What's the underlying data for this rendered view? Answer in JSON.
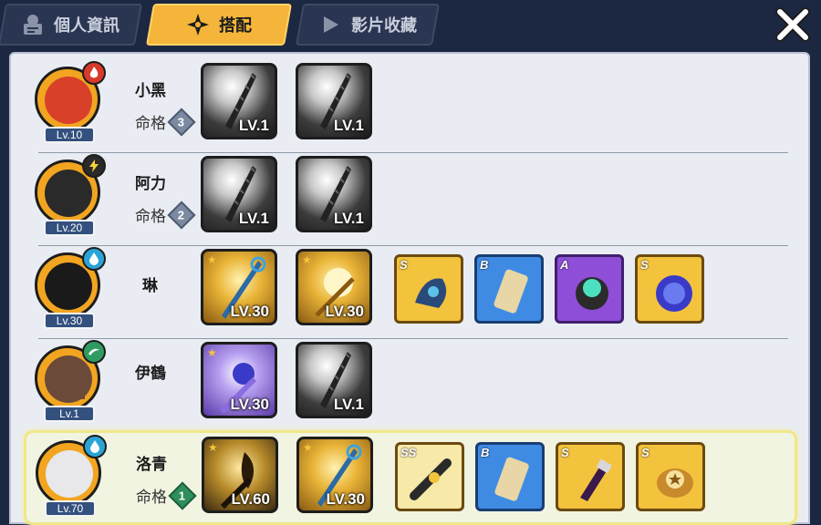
{
  "tabs": [
    {
      "label": "個人資訊",
      "icon": "profile-icon"
    },
    {
      "label": "搭配",
      "icon": "shuriken-icon"
    },
    {
      "label": "影片收藏",
      "icon": "play-icon"
    }
  ],
  "active_tab": 1,
  "close_icon": "close-icon",
  "colors": {
    "active_tab": "#f4b53a",
    "fire": "#d83a2b",
    "thunder": "#e7c43a",
    "water": "#2aa4d6",
    "wind": "#2e9c62"
  },
  "characters": [
    {
      "name": "小黑",
      "level": "Lv.10",
      "element": "fire-icon",
      "destiny_label": "命格",
      "destiny": "3",
      "weapons": [
        {
          "level": "LV.1",
          "style": "grey"
        },
        {
          "level": "LV.1",
          "style": "grey"
        }
      ],
      "items": []
    },
    {
      "name": "阿力",
      "level": "Lv.20",
      "element": "thunder-icon",
      "destiny_label": "命格",
      "destiny": "2",
      "weapons": [
        {
          "level": "LV.1",
          "style": "grey"
        },
        {
          "level": "LV.1",
          "style": "grey"
        }
      ],
      "items": []
    },
    {
      "name": "琳",
      "level": "Lv.30",
      "element": "water-icon",
      "destiny_label": "",
      "destiny": "",
      "weapons": [
        {
          "level": "LV.30",
          "style": "gold"
        },
        {
          "level": "LV.30",
          "style": "gold"
        }
      ],
      "items": [
        {
          "grade": "S"
        },
        {
          "grade": "B"
        },
        {
          "grade": "A"
        },
        {
          "grade": "S"
        }
      ]
    },
    {
      "name": "伊鶴",
      "level": "Lv.1",
      "element": "wind-icon",
      "destiny_label": "",
      "destiny": "",
      "weapons": [
        {
          "level": "LV.30",
          "style": "gold"
        },
        {
          "level": "LV.1",
          "style": "grey"
        }
      ],
      "items": []
    },
    {
      "name": "洛青",
      "level": "Lv.70",
      "element": "water-icon",
      "destiny_label": "命格",
      "destiny": "1",
      "weapons": [
        {
          "level": "LV.60",
          "style": "gold"
        },
        {
          "level": "LV.30",
          "style": "gold"
        }
      ],
      "items": [
        {
          "grade": "SS"
        },
        {
          "grade": "B"
        },
        {
          "grade": "S"
        },
        {
          "grade": "S"
        }
      ]
    }
  ]
}
